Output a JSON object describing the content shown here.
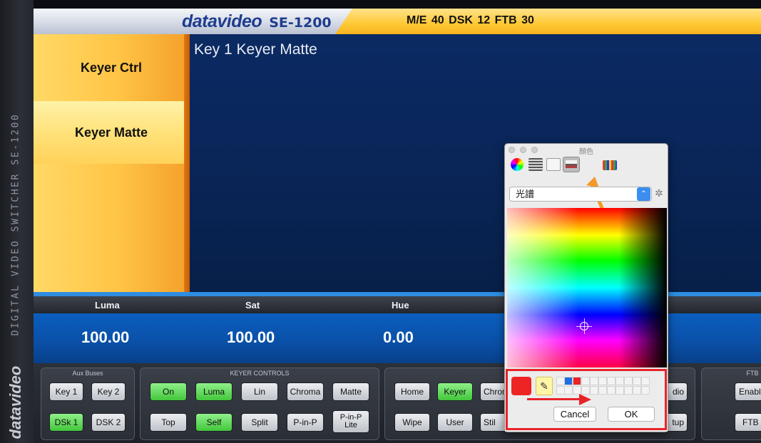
{
  "brand": {
    "name": "datavideo",
    "model": "SE-1200"
  },
  "header": {
    "status": "M/E 40  DSK 12  FTB 30"
  },
  "side": {
    "vertical_text": "DIGITAL VIDEO SWITCHER  SE-1200",
    "logo": "datavideo"
  },
  "menu": {
    "keyer_ctrl": "Keyer Ctrl",
    "keyer_matte": "Keyer Matte"
  },
  "main": {
    "title": "Key 1 Keyer Matte"
  },
  "params": {
    "labels": {
      "luma": "Luma",
      "sat": "Sat",
      "hue": "Hue"
    },
    "values": {
      "luma": "100.00",
      "sat": "100.00",
      "hue": "0.00"
    }
  },
  "groups": {
    "aux": {
      "title": "Aux Buses",
      "buttons": [
        "Key 1",
        "Key 2",
        "DSk 1",
        "DSK 2"
      ]
    },
    "keyer": {
      "title": "KEYER CONTROLS",
      "buttons": [
        "On",
        "Luma",
        "Lin",
        "Chroma",
        "Matte",
        "Top",
        "Self",
        "Split",
        "P-in-P",
        "P-in-P Lite"
      ]
    },
    "menu": {
      "buttons": [
        "Home",
        "Keyer",
        "Chrom",
        "Wipe",
        "User",
        "Stil",
        "dio",
        "tup"
      ]
    },
    "ftb": {
      "title": "FTB",
      "buttons": [
        "Enabl",
        "FTB"
      ]
    }
  },
  "picker": {
    "title": "顏色",
    "mode": "光譜",
    "cancel": "Cancel",
    "ok": "OK",
    "current_color": "#ee2424",
    "swatch_colors": [
      "#1f6fe0",
      "#e8232a"
    ]
  },
  "colors": {
    "accent_orange": "#f4a02a",
    "panel_blue": "#0a2558",
    "active_green": "#43c63b",
    "highlight_red": "#e8232a"
  }
}
